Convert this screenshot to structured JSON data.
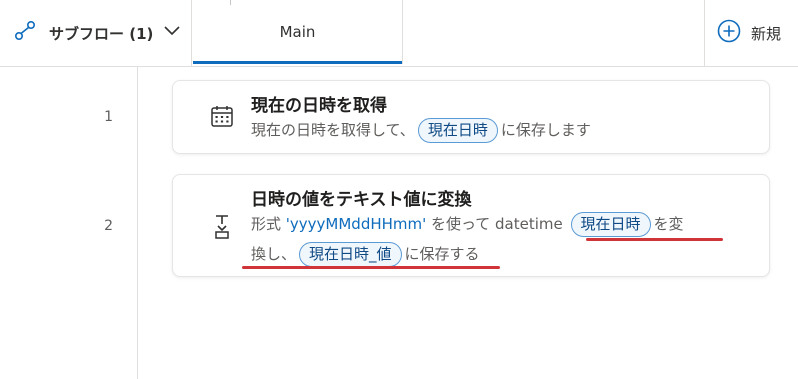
{
  "header": {
    "subflow_label": "サブフロー (1)",
    "main_tab": "Main",
    "new_label": "新規"
  },
  "actions": [
    {
      "line": "1",
      "title": "現在の日時を取得",
      "desc_prefix": "現在の日時を取得して、",
      "var": "現在日時",
      "desc_suffix": "に保存します"
    },
    {
      "line": "2",
      "title": "日時の値をテキスト値に変換",
      "desc_1": "形式 ",
      "format": "'yyyyMMddHHmm'",
      "desc_2": " を使って datetime ",
      "var_in": "現在日時",
      "desc_3": "を変",
      "desc_4": "換し、",
      "var_out": "現在日時_値",
      "desc_5": "に保存する"
    }
  ],
  "colors": {
    "accent": "#0f6cbd",
    "annotation": "#d13438"
  }
}
